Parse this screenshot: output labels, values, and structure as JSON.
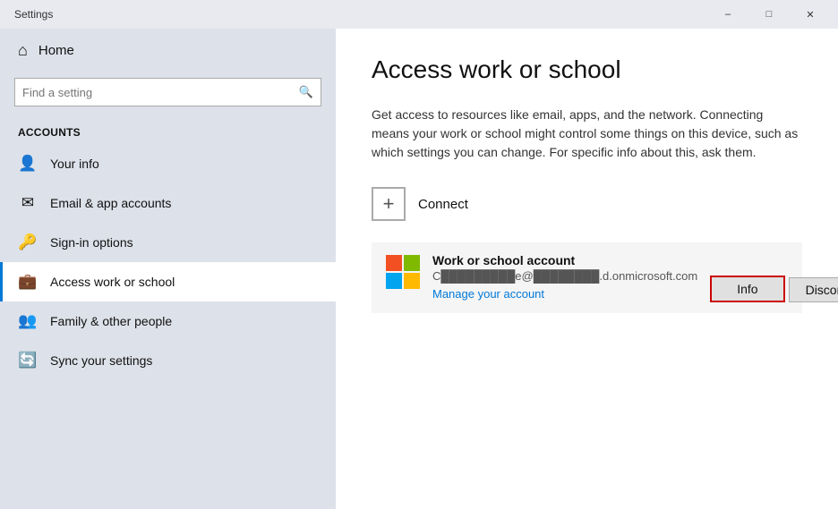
{
  "titleBar": {
    "title": "Settings",
    "minLabel": "–",
    "maxLabel": "□",
    "closeLabel": "✕"
  },
  "sidebar": {
    "backArrow": "←",
    "home": {
      "icon": "⌂",
      "label": "Home"
    },
    "search": {
      "placeholder": "Find a setting",
      "icon": "🔍"
    },
    "sectionLabel": "Accounts",
    "navItems": [
      {
        "id": "your-info",
        "icon": "👤",
        "label": "Your info",
        "active": false
      },
      {
        "id": "email-accounts",
        "icon": "✉",
        "label": "Email & app accounts",
        "active": false
      },
      {
        "id": "sign-in",
        "icon": "🔑",
        "label": "Sign-in options",
        "active": false
      },
      {
        "id": "work-school",
        "icon": "💼",
        "label": "Access work or school",
        "active": true
      },
      {
        "id": "family",
        "icon": "👥",
        "label": "Family & other people",
        "active": false
      },
      {
        "id": "sync",
        "icon": "🔄",
        "label": "Sync your settings",
        "active": false
      }
    ]
  },
  "main": {
    "pageTitle": "Access work or school",
    "description": "Get access to resources like email, apps, and the network. Connecting means your work or school might control some things on this device, such as which settings you can change. For specific info about this, ask them.",
    "connectLabel": "Connect",
    "connectPlusIcon": "+",
    "account": {
      "type": "Work or school account",
      "emailMasked": "C█████████e@████████.d.onmicrosoft.com",
      "manageLabel": "Manage your account",
      "infoBtnLabel": "Info",
      "disconnectBtnLabel": "Disconnect"
    }
  }
}
